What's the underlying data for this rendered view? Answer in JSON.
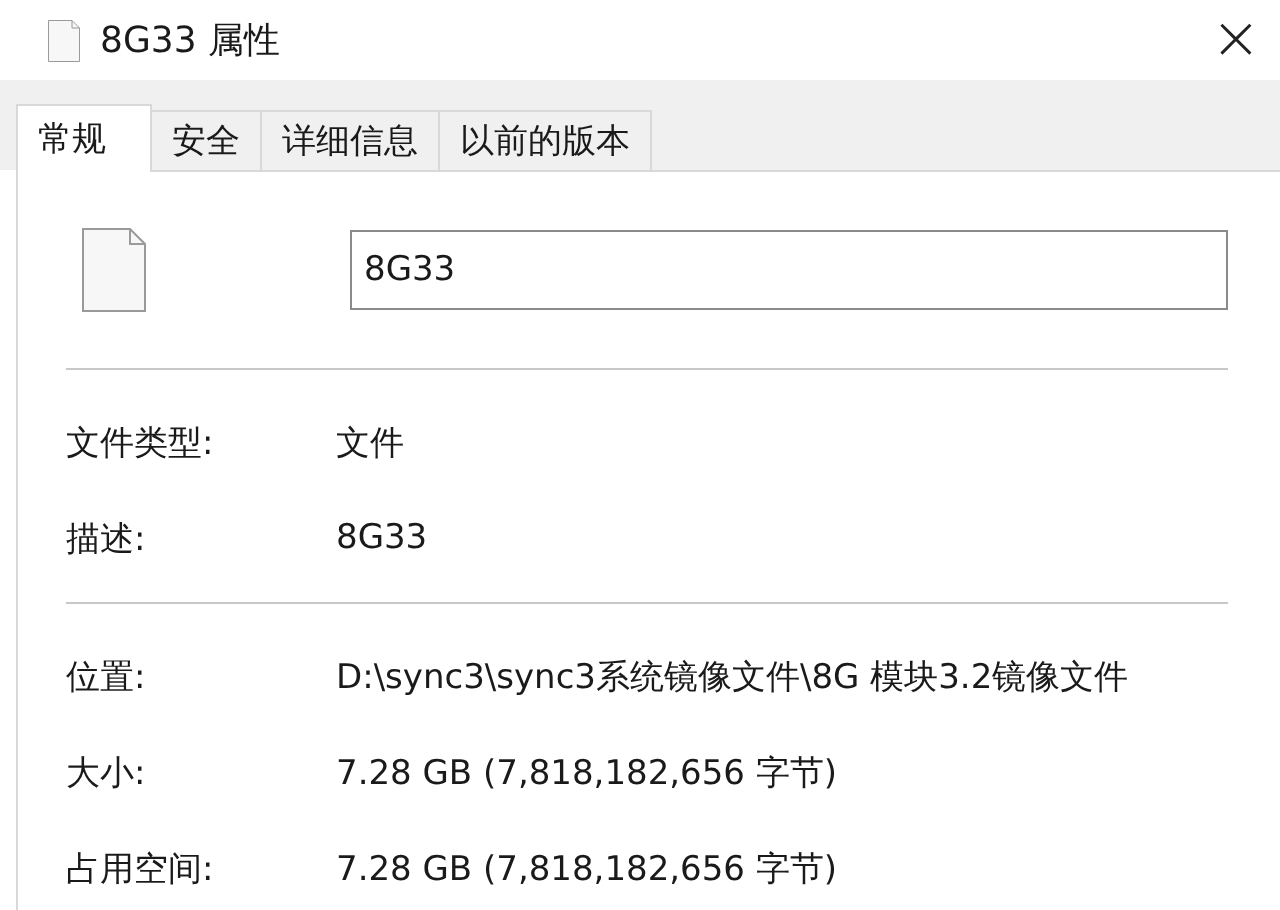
{
  "window": {
    "title": "8G33 属性",
    "close": "×"
  },
  "tabs": [
    {
      "label": "常规",
      "selected": true
    },
    {
      "label": "安全",
      "selected": false
    },
    {
      "label": "详细信息",
      "selected": false
    },
    {
      "label": "以前的版本",
      "selected": false
    }
  ],
  "name_field": {
    "value": "8G33"
  },
  "sections": [
    [
      {
        "label": "文件类型:",
        "value": "文件"
      },
      {
        "label": "描述:",
        "value": "8G33"
      }
    ],
    [
      {
        "label": "位置:",
        "value": "D:\\sync3\\sync3系统镜像文件\\8G 模块3.2镜像文件"
      },
      {
        "label": "大小:",
        "value": "7.28 GB (7,818,182,656 字节)"
      },
      {
        "label": "占用空间:",
        "value": "7.28 GB (7,818,182,656 字节)"
      }
    ]
  ]
}
